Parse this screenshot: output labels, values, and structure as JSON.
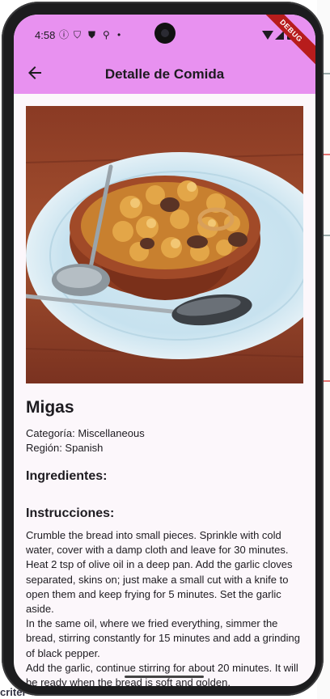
{
  "status_bar": {
    "time": "4:58",
    "debug_banner": "DEBUG"
  },
  "app_bar": {
    "title": "Detalle de Comida",
    "back_icon": "arrow-back-icon"
  },
  "meal": {
    "name": "Migas",
    "category": "Categoría: Miscellaneous",
    "region": "Región: Spanish",
    "ingredients_heading": "Ingredientes:",
    "instructions_heading": "Instrucciones:",
    "instructions": "Crumble the bread into small pieces. Sprinkle with cold water, cover with a damp cloth and leave for 30 minutes. Heat 2 tsp of olive oil in a deep pan. Add the garlic cloves separated, skins on; just make a small cut with a knife to open them and keep frying for 5 minutes. Set the garlic aside.\nIn the same oil, where we fried everything, simmer the bread, stirring constantly for 15 minutes and add a grinding of black pepper.\nAdd the garlic, continue stirring for about 20 minutes. It will be ready when the bread is soft and golden."
  },
  "background_page": {
    "bottom_text": "criter"
  },
  "colors": {
    "app_bar": "#e891f0",
    "page_background": "#fcf7fb",
    "text": "#1d1b20"
  }
}
